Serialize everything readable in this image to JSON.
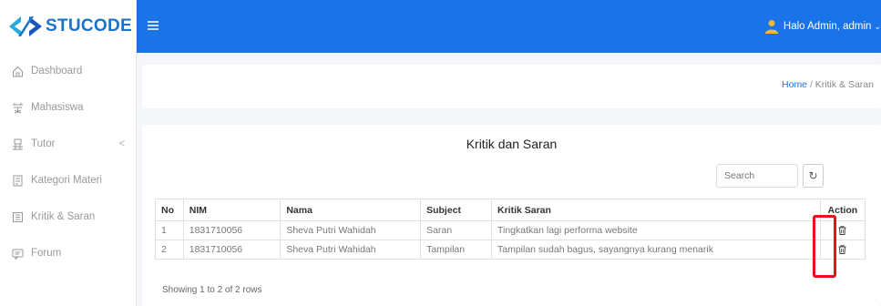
{
  "brand": {
    "name": "STUCODE",
    "accent": "#1a73e8"
  },
  "sidebar": {
    "items": [
      {
        "label": "Dashboard",
        "icon": "home-icon"
      },
      {
        "label": "Mahasiswa",
        "icon": "students-icon"
      },
      {
        "label": "Tutor",
        "icon": "tutor-icon",
        "chevron": "<"
      },
      {
        "label": "Kategori Materi",
        "icon": "category-icon"
      },
      {
        "label": "Kritik & Saran",
        "icon": "feedback-icon"
      },
      {
        "label": "Forum",
        "icon": "forum-icon"
      }
    ]
  },
  "topbar": {
    "user_label": "Halo Admin, admin"
  },
  "breadcrumb": {
    "home": "Home",
    "separator": " / ",
    "current": "Kritik & Saran"
  },
  "main": {
    "title": "Kritik dan Saran",
    "search_placeholder": "Search",
    "table": {
      "headers": [
        "No",
        "NIM",
        "Nama",
        "Subject",
        "Kritik Saran",
        "Action"
      ],
      "rows": [
        [
          "1",
          "1831710056",
          "Sheva Putri Wahidah",
          "Saran",
          "Tingkatkan lagi performa website"
        ],
        [
          "2",
          "1831710056",
          "Sheva Putri Wahidah",
          "Tampilan",
          "Tampilan sudah bagus, sayangnya kurang menarik"
        ]
      ]
    },
    "footer": "Showing 1 to 2 of 2 rows"
  }
}
